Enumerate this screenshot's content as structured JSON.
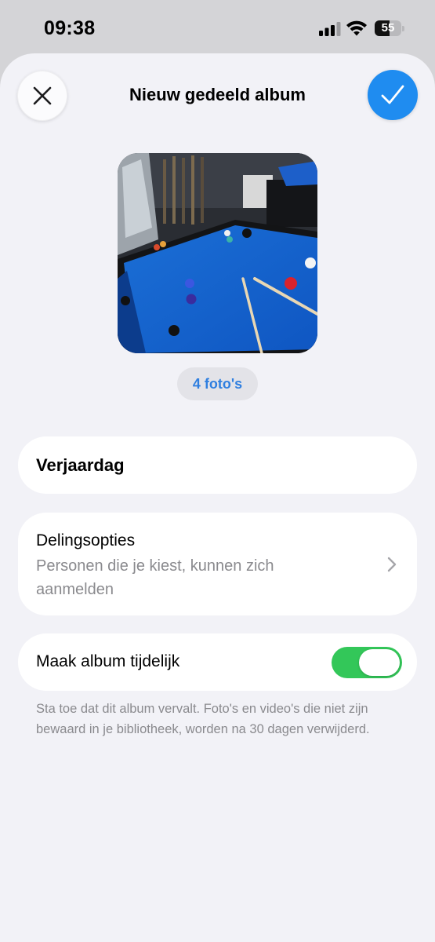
{
  "status_bar": {
    "time": "09:38",
    "battery_level": "55",
    "battery_percent": 55
  },
  "header": {
    "title": "Nieuw gedeeld album",
    "close_icon": "close-icon",
    "confirm_icon": "checkmark-icon",
    "accent_color": "#1f8cf0"
  },
  "album": {
    "photo_count_label": "4 foto's",
    "name": "Verjaardag"
  },
  "sharing": {
    "title": "Delingsopties",
    "description": "Personen die je kiest, kunnen zich aanmelden"
  },
  "temporary": {
    "label": "Maak album tijdelijk",
    "enabled": true,
    "toggle_color": "#33c759",
    "footnote": "Sta toe dat dit album vervalt. Foto's en video's die niet zijn bewaard in je bibliotheek, worden na 30 dagen verwijderd."
  }
}
